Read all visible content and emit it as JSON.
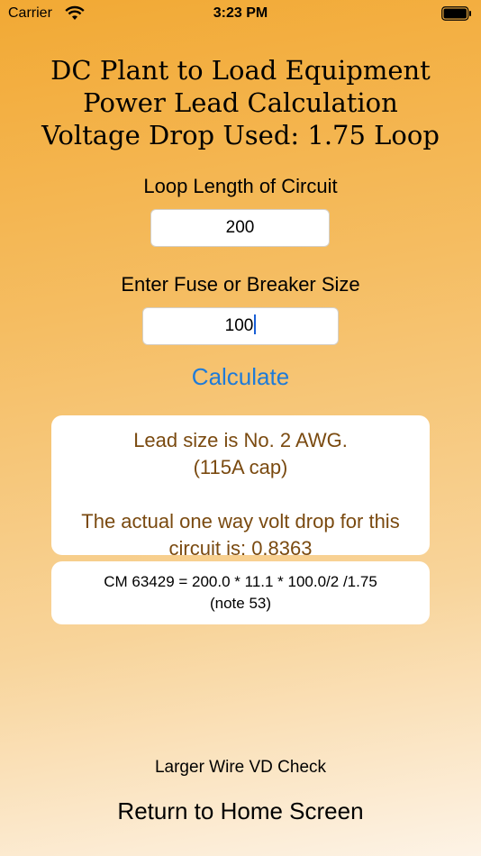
{
  "status_bar": {
    "carrier": "Carrier",
    "time": "3:23 PM",
    "wifi_icon": "wifi-icon",
    "battery_icon": "battery-icon"
  },
  "title": {
    "line1": "DC Plant to Load Equipment",
    "line2": "Power Lead Calculation",
    "line3": "Voltage Drop Used: 1.75 Loop"
  },
  "loop_length": {
    "label": "Loop Length of Circuit",
    "value": "200"
  },
  "fuse_size": {
    "label": "Enter Fuse or Breaker Size",
    "value": "100"
  },
  "calculate_label": "Calculate",
  "result": {
    "line1": "Lead size is No. 2 AWG.",
    "line2": "(115A cap)",
    "line3": "The actual one way volt drop for this",
    "line4": "circuit is: 0.8363"
  },
  "formula": {
    "line1": "CM 63429 = 200.0 * 11.1 * 100.0/2 /1.75",
    "line2": "(note 53)"
  },
  "larger_wire_label": "Larger Wire VD Check",
  "return_home_label": "Return to Home Screen",
  "colors": {
    "accent": "#1f7bd8",
    "result_text": "#7a4a10",
    "gradient_top": "#f2a934",
    "gradient_bottom": "#fdf3e6"
  }
}
